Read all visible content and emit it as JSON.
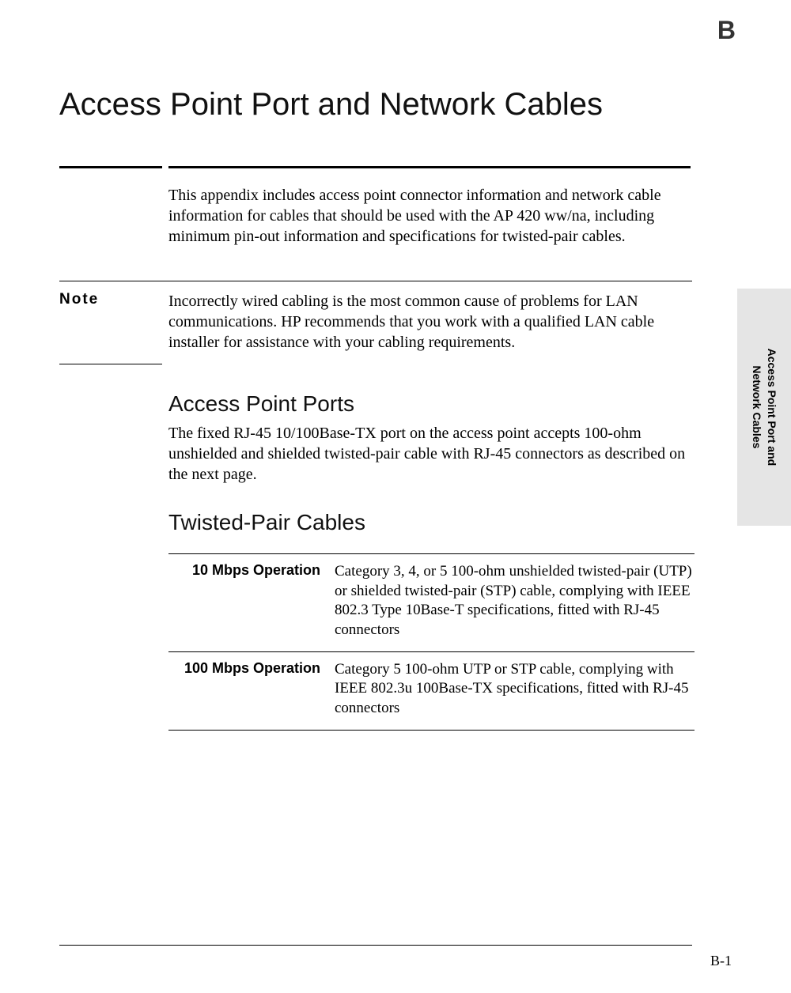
{
  "appendix_letter": "B",
  "side_tab": {
    "line1": "Access Point Port and",
    "line2": "Network Cables"
  },
  "title": "Access Point Port and Network Cables",
  "intro": "This appendix includes access point connector information and network cable information for cables that should be used with the AP 420 ww/na, including minimum pin-out information and specifications for twisted-pair cables.",
  "note": {
    "label": "Note",
    "body": "Incorrectly wired cabling is the most common cause of problems for LAN communications. HP recommends that you work with a qualified LAN cable installer for assistance with your cabling requirements."
  },
  "sections": {
    "ports": {
      "heading": "Access Point Ports",
      "body": "The fixed RJ-45 10/100Base-TX port on the access point accepts 100-ohm unshielded and shielded twisted-pair cable with RJ-45 connectors as described on the next page."
    },
    "twisted": {
      "heading": "Twisted-Pair Cables"
    }
  },
  "cable_specs": [
    {
      "label": "10 Mbps Operation",
      "desc": "Category 3, 4, or 5 100-ohm unshielded twisted-pair (UTP) or shielded twisted-pair (STP) cable, complying with IEEE 802.3 Type 10Base-T specifications, fitted with RJ-45 connectors"
    },
    {
      "label": "100 Mbps Operation",
      "desc": "Category 5 100-ohm UTP or STP cable, complying with IEEE 802.3u 100Base-TX specifications, fitted with RJ-45 connectors"
    }
  ],
  "page_number": "B-1"
}
